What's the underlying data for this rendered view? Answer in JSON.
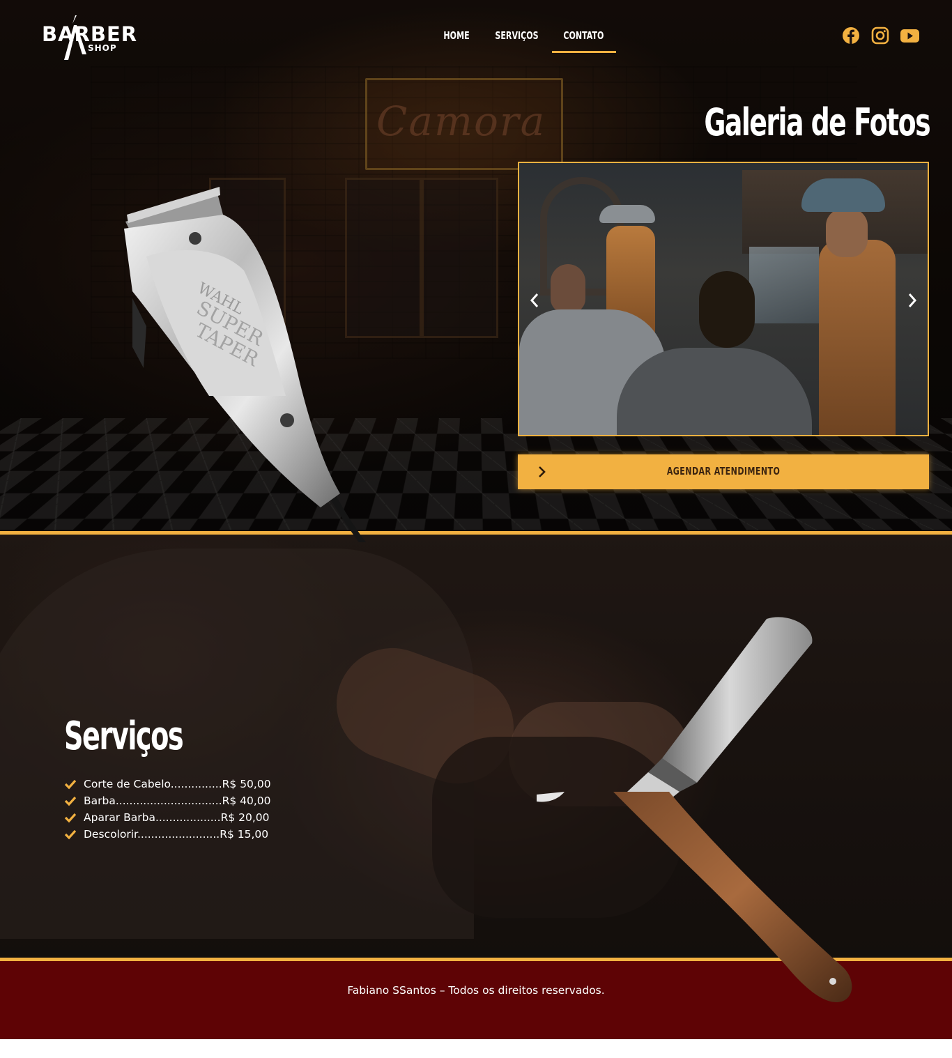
{
  "header": {
    "logo": {
      "main": "BARBER",
      "sub": "SHOP"
    },
    "nav": [
      {
        "label": "HOME",
        "active": false
      },
      {
        "label": "SERVIÇOS",
        "active": false
      },
      {
        "label": "CONTATO",
        "active": true
      }
    ],
    "social": [
      "facebook-icon",
      "instagram-icon",
      "youtube-icon"
    ]
  },
  "gallery": {
    "title": "Galeria de Fotos",
    "prev_icon": "chevron-left-icon",
    "next_icon": "chevron-right-icon"
  },
  "cta": {
    "label": "AGENDAR ATENDIMENTO",
    "icon": "chevron-right-icon"
  },
  "services": {
    "title": "Serviços",
    "items": [
      {
        "text": "Corte de Cabelo...............R$ 50,00"
      },
      {
        "text": "Barba...............................R$ 40,00"
      },
      {
        "text": "Aparar Barba...................R$ 20,00"
      },
      {
        "text": "Descolorir........................R$ 15,00"
      }
    ]
  },
  "footer": {
    "copyright": "Fabiano SSantos – Todos os direitos reservados."
  },
  "colors": {
    "accent": "#f2b141",
    "footer_bg": "#5e0305",
    "text": "#ffffff"
  }
}
